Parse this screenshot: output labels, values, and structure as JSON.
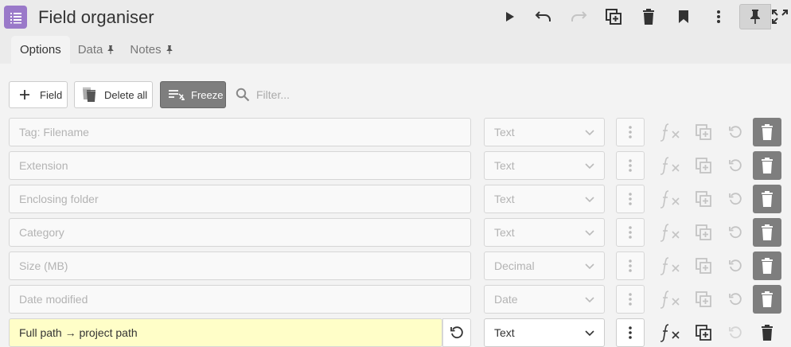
{
  "app": {
    "title": "Field organiser",
    "icon": "list-icon",
    "accent": "#9a79c9"
  },
  "toolbar_icons": [
    {
      "name": "play-icon",
      "state": "enabled"
    },
    {
      "name": "undo-icon",
      "state": "enabled"
    },
    {
      "name": "redo-icon",
      "state": "disabled"
    },
    {
      "name": "duplicate-icon",
      "state": "enabled"
    },
    {
      "name": "trash-icon",
      "state": "enabled"
    },
    {
      "name": "bookmark-icon",
      "state": "enabled"
    },
    {
      "name": "more-vertical-icon",
      "state": "enabled"
    },
    {
      "name": "pin-icon",
      "state": "pressed"
    },
    {
      "name": "fullscreen-icon",
      "state": "enabled"
    }
  ],
  "tabs": [
    {
      "label": "Options",
      "active": true,
      "pinned": false
    },
    {
      "label": "Data",
      "active": false,
      "pinned": true
    },
    {
      "label": "Notes",
      "active": false,
      "pinned": true
    }
  ],
  "actions": {
    "add_field_label": "Field",
    "delete_all_label": "Delete all",
    "freeze_label": "Freeze",
    "freeze_color": "#7e7e7e",
    "filter_placeholder": "Filter..."
  },
  "fields": [
    {
      "name": "Tag: Filename",
      "type": "Text",
      "active": false
    },
    {
      "name": "Extension",
      "type": "Text",
      "active": false
    },
    {
      "name": "Enclosing folder",
      "type": "Text",
      "active": false
    },
    {
      "name": "Category",
      "type": "Text",
      "active": false
    },
    {
      "name": "Size (MB)",
      "type": "Decimal",
      "active": false
    },
    {
      "name": "Date modified",
      "type": "Date",
      "active": false
    },
    {
      "name": "Full path → project path",
      "type": "Text",
      "active": true
    }
  ],
  "colors": {
    "active_row_bg": "#fffec8",
    "delete_bg": "#7e7e7e",
    "header_bg": "#ebebeb",
    "body_bg": "#f3f3f3"
  }
}
